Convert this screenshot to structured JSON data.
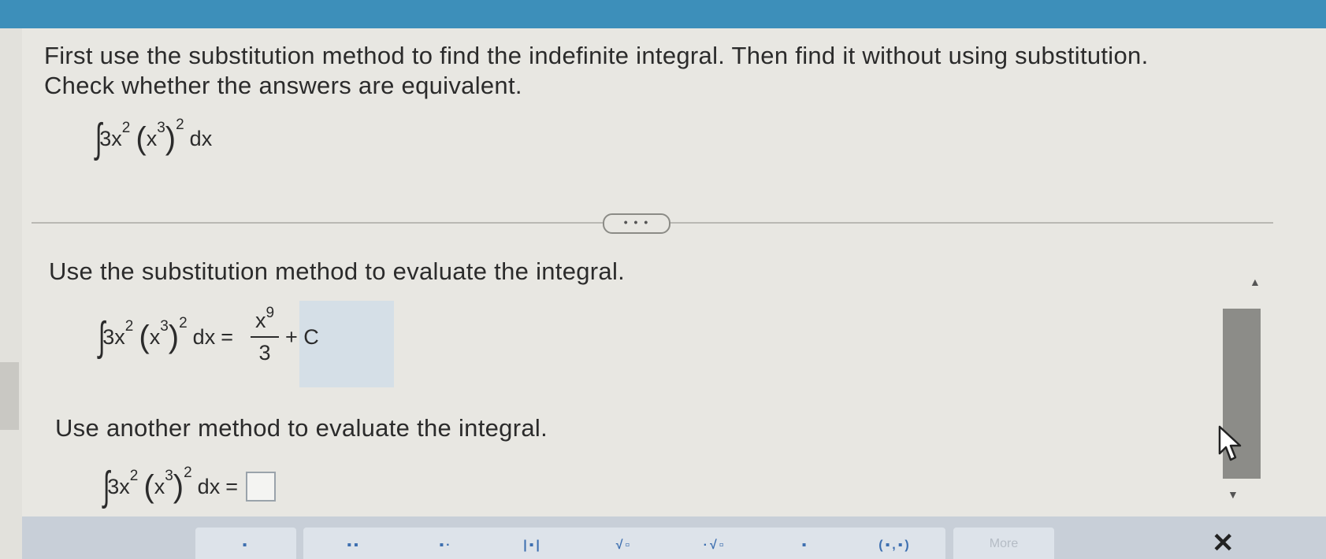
{
  "question": {
    "line1": "First use the substitution method to find the indefinite integral. Then find it without using substitution.",
    "line2": "Check whether the answers are equivalent."
  },
  "integrand": {
    "coef": "3x",
    "coef_exp": "2",
    "open": "(",
    "inner": "x",
    "inner_exp": "3",
    "close": ")",
    "outer_exp": "2",
    "dx": "dx",
    "equals": "="
  },
  "expand_button": {
    "label": "• • •"
  },
  "part1": {
    "prompt": "Use the substitution method to evaluate the integral.",
    "answer_num_base": "x",
    "answer_num_exp": "9",
    "answer_den": "3",
    "answer_const": "+ C"
  },
  "part2": {
    "prompt": "Use another method to evaluate the integral."
  },
  "scrollbar": {
    "up": "▲",
    "down": "▼"
  },
  "toolbar": {
    "buttons": [
      "▪",
      "▪▪",
      "▪·",
      "|▪|",
      "√▫",
      "·√▫",
      "▪",
      "(▪,▪)"
    ],
    "more": "More",
    "close": "✕"
  },
  "icons": {
    "cursor": "mouse-pointer-icon",
    "close": "close-icon"
  }
}
